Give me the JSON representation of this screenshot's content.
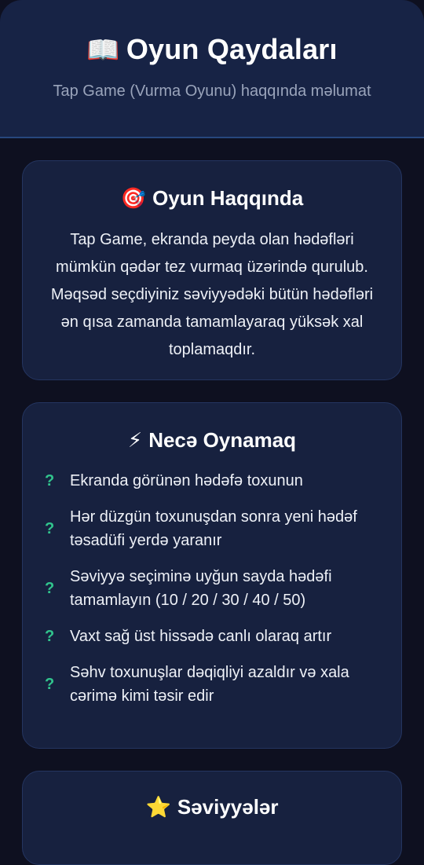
{
  "header": {
    "icon": "book-icon",
    "icon_glyph": "📖",
    "title": "Oyun Qaydaları",
    "subtitle": "Tap Game (Vurma Oyunu) haqqında məlumat"
  },
  "about": {
    "icon": "target-icon",
    "icon_glyph": "🎯",
    "title": "Oyun Haqqında",
    "text": "Tap Game, ekranda peyda olan hədəfləri mümkün qədər tez vurmaq üzərində qurulub. Məqsəd seçdiyiniz səviyyədəki bütün hədəfləri ən qısa zamanda tamamlayaraq yüksək xal toplamaqdır."
  },
  "how_to_play": {
    "icon": "lightning-icon",
    "icon_glyph": "⚡",
    "title": "Necə Oynamaq",
    "bullet_glyph": "?",
    "rules": [
      "Ekranda görünən hədəfə toxunun",
      "Hər düzgün toxunuşdan sonra yeni hədəf təsadüfi yerdə yaranır",
      "Səviyyə seçiminə uyğun sayda hədəfi tamamlayın (10 / 20 / 30 / 40 / 50)",
      "Vaxt sağ üst hissədə canlı olaraq artır",
      "Səhv toxunuşlar dəqiqliyi azaldır və xala cərimə kimi təsir edir"
    ]
  },
  "levels": {
    "icon": "star-icon",
    "icon_glyph": "⭐",
    "title": "Səviyyələr"
  },
  "colors": {
    "background": "#0e1020",
    "header_bg": "#172345",
    "card_bg": "#17213f",
    "accent_green": "#31c48d",
    "muted_text": "#9aa4bb"
  }
}
